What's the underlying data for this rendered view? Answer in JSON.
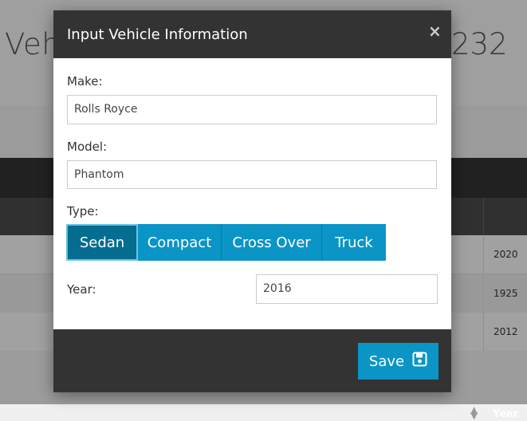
{
  "background": {
    "title_left": "Veh",
    "title_right": "232",
    "table": {
      "year_header": "Year",
      "rows": [
        {
          "year": "2020"
        },
        {
          "year": "1925"
        },
        {
          "year": "2012"
        }
      ]
    }
  },
  "modal": {
    "title": "Input Vehicle Information",
    "close_label": "×",
    "make": {
      "label": "Make:",
      "value": "Rolls Royce"
    },
    "model": {
      "label": "Model:",
      "value": "Phantom"
    },
    "type": {
      "label": "Type:",
      "options": [
        "Sedan",
        "Compact",
        "Cross Over",
        "Truck"
      ],
      "selected": "Sedan"
    },
    "year": {
      "label": "Year:",
      "value": "2016"
    },
    "save_label": "Save",
    "save_icon": "floppy-disk-icon"
  },
  "colors": {
    "accent": "#0a95c6",
    "accent_active": "#046d90",
    "header_dark": "#333333"
  }
}
